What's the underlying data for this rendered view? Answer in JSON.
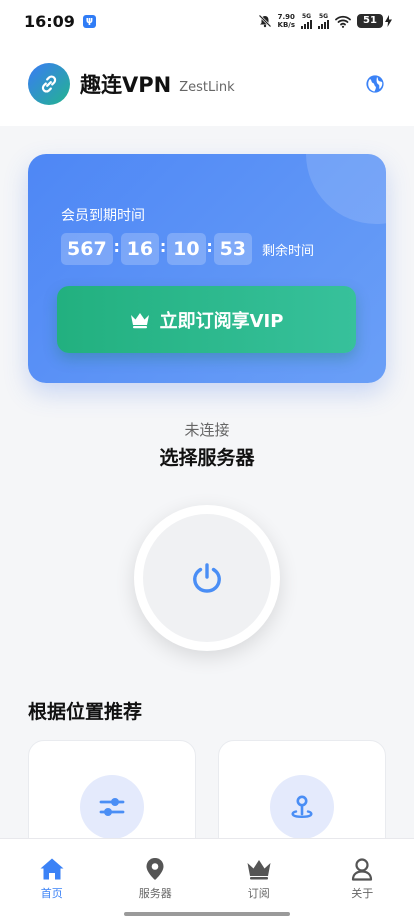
{
  "status_bar": {
    "time": "16:09",
    "app_badge": "ψ",
    "speed_value": "7.90",
    "speed_unit": "KB/s",
    "net1": "5G",
    "net2": "5G",
    "battery": "51"
  },
  "header": {
    "title": "趣连VPN",
    "subtitle": "ZestLink"
  },
  "vip": {
    "label": "会员到期时间",
    "days": "567",
    "hours": "16",
    "minutes": "10",
    "seconds": "53",
    "remaining_label": "剩余时间",
    "button_label": "立即订阅享VIP"
  },
  "connection": {
    "status": "未连接",
    "server_prompt": "选择服务器"
  },
  "recommend": {
    "title": "根据位置推荐"
  },
  "nav": {
    "items": [
      {
        "label": "首页",
        "icon": "home-icon",
        "active": true
      },
      {
        "label": "服务器",
        "icon": "location-pin-icon",
        "active": false
      },
      {
        "label": "订阅",
        "icon": "crown-icon",
        "active": false
      },
      {
        "label": "关于",
        "icon": "user-icon",
        "active": false
      }
    ]
  },
  "colors": {
    "accent": "#3b82f6",
    "card_gradient_start": "#4e87f5",
    "vip_button": "#22b07f"
  }
}
